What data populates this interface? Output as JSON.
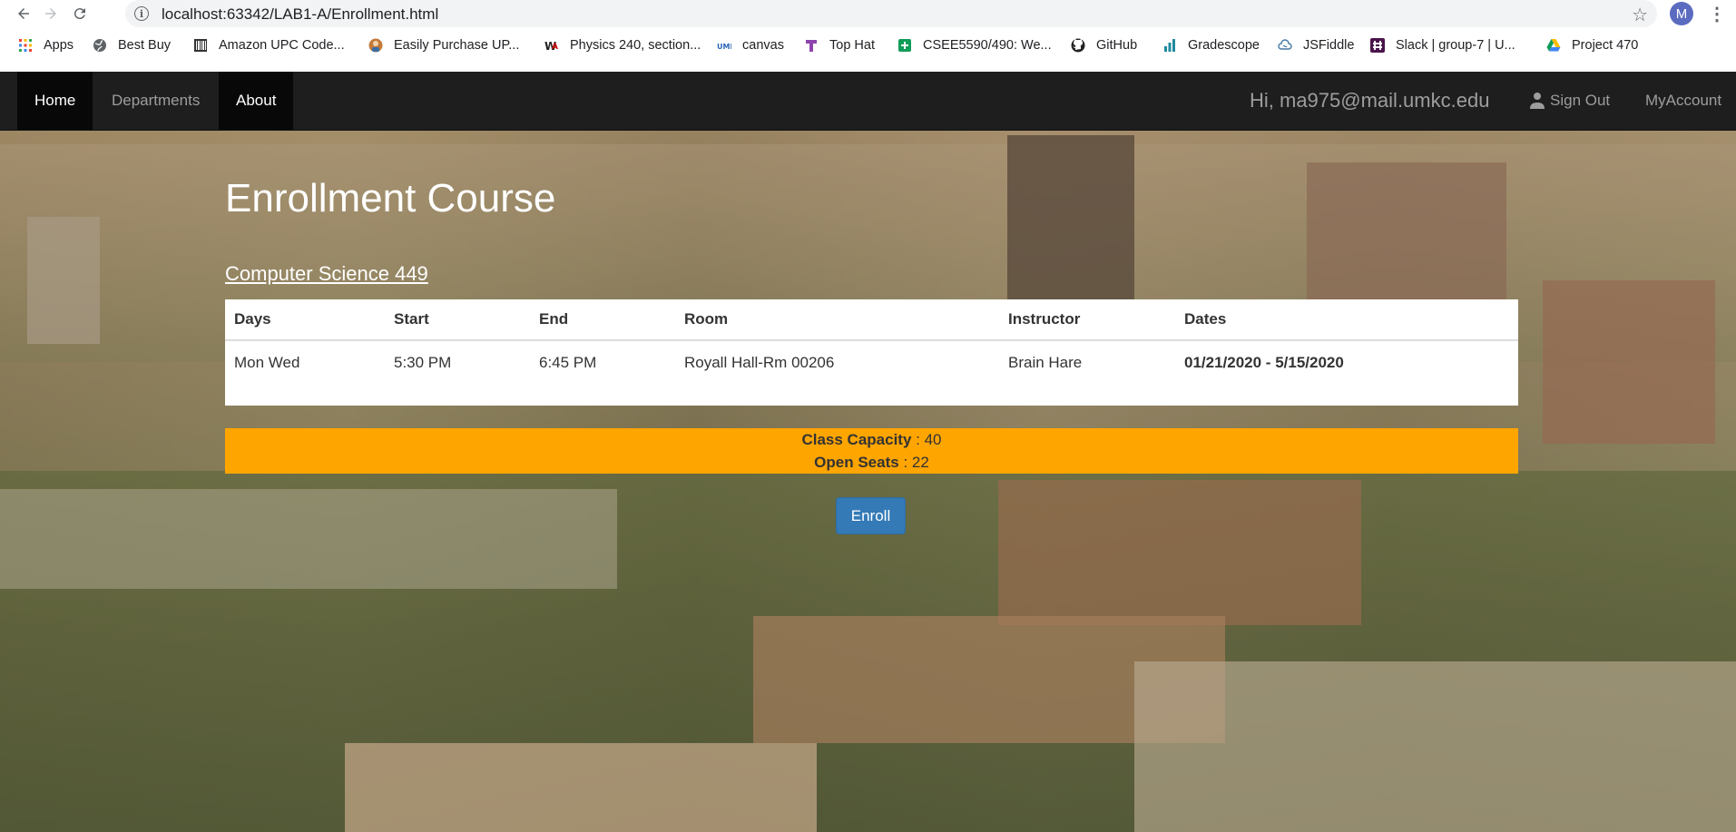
{
  "browser": {
    "url": "localhost:63342/LAB1-A/Enrollment.html",
    "profile_initial": "M",
    "bookmarks": [
      {
        "label": "Apps",
        "icon": "apps-grid-icon"
      },
      {
        "label": "Best Buy",
        "icon": "globe-icon"
      },
      {
        "label": "Amazon UPC Code...",
        "icon": "barcode-icon"
      },
      {
        "label": "Easily Purchase UP...",
        "icon": "avatar-icon"
      },
      {
        "label": "Physics 240, section...",
        "icon": "webassign-icon"
      },
      {
        "label": "canvas",
        "icon": "umkc-icon"
      },
      {
        "label": "Top Hat",
        "icon": "tophat-icon"
      },
      {
        "label": "CSEE5590/490: We...",
        "icon": "sheets-icon"
      },
      {
        "label": "GitHub",
        "icon": "github-icon"
      },
      {
        "label": "Gradescope",
        "icon": "gradescope-icon"
      },
      {
        "label": "JSFiddle",
        "icon": "jsfiddle-icon"
      },
      {
        "label": "Slack | group-7 | U...",
        "icon": "slack-icon"
      },
      {
        "label": "Project 470",
        "icon": "drive-icon"
      }
    ]
  },
  "nav": {
    "items": [
      "Home",
      "Departments",
      "About"
    ],
    "greeting": "Hi, ma975@mail.umkc.edu",
    "sign_out": "Sign Out",
    "my_account": "MyAccount"
  },
  "page": {
    "title": "Enrollment Course",
    "course": "Computer Science 449"
  },
  "schedule": {
    "headers": [
      "Days",
      "Start",
      "End",
      "Room",
      "Instructor",
      "Dates"
    ],
    "row": [
      "Mon Wed",
      "5:30 PM",
      "6:45 PM",
      "Royall Hall-Rm 00206",
      "Brain Hare",
      "01/21/2020 - 5/15/2020"
    ]
  },
  "capacity": {
    "capacity_label": "Class Capacity",
    "capacity_value": " : 40",
    "open_label": "Open Seats",
    "open_value": " : 22"
  },
  "enroll_label": "Enroll",
  "colors": {
    "navbar": "#1e1e1e",
    "capacity_bar": "#ffa500",
    "button": "#337ab7"
  }
}
